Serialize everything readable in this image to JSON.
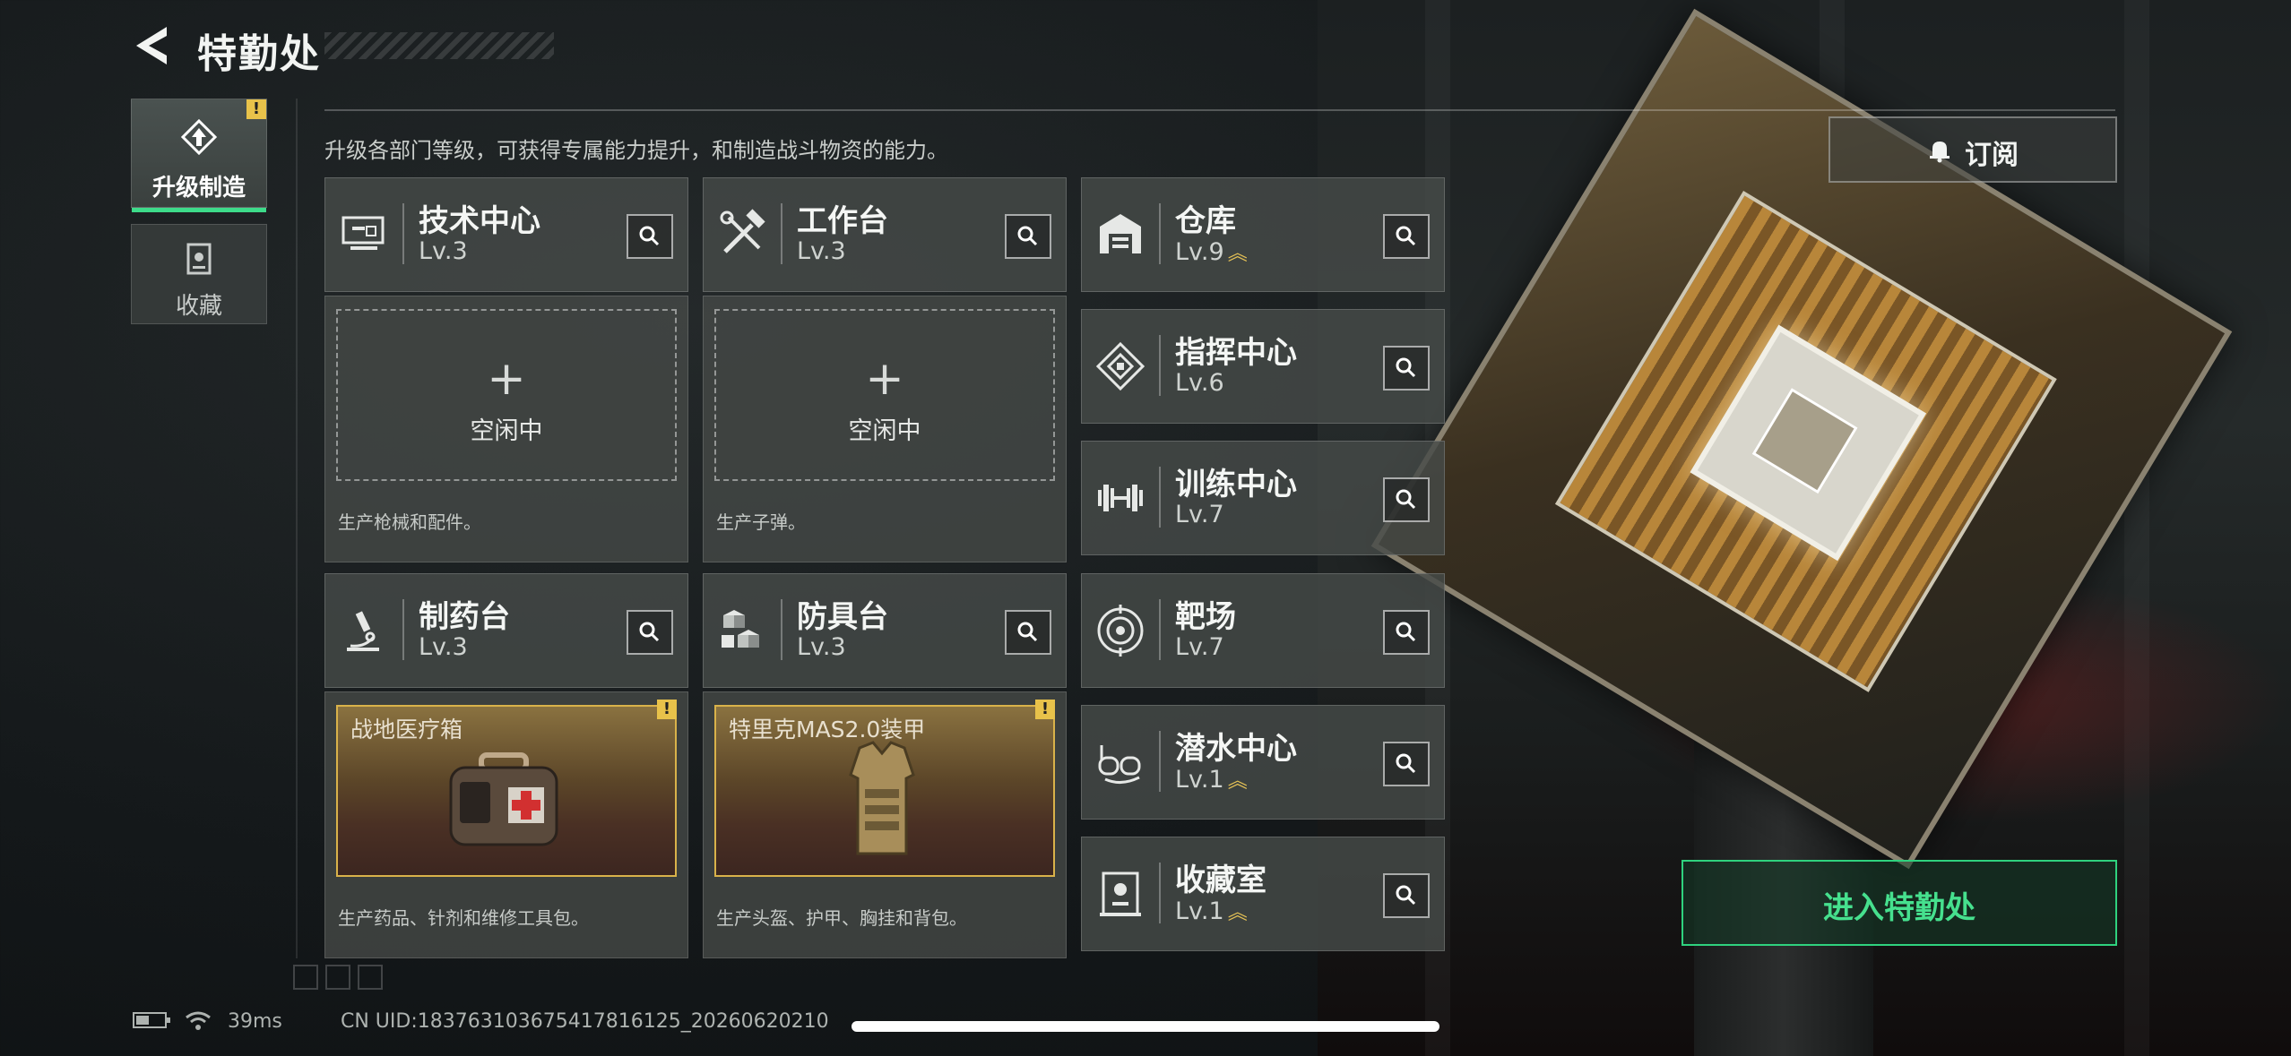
{
  "header": {
    "title": "特勤处",
    "subtitle": "升级各部门等级，可获得专属能力提升，和制造战斗物资的能力。"
  },
  "nav": {
    "tabs": [
      {
        "label": "升级制造",
        "active": true,
        "alert": "!"
      },
      {
        "label": "收藏",
        "active": false
      }
    ]
  },
  "cards": {
    "tech": {
      "name": "技术中心",
      "level": "Lv.3"
    },
    "workbench": {
      "name": "工作台",
      "level": "Lv.3"
    },
    "warehouse": {
      "name": "仓库",
      "level": "Lv.9"
    },
    "command": {
      "name": "指挥中心",
      "level": "Lv.6"
    },
    "training": {
      "name": "训练中心",
      "level": "Lv.7"
    },
    "pharmacy": {
      "name": "制药台",
      "level": "Lv.3"
    },
    "armor": {
      "name": "防具台",
      "level": "Lv.3"
    },
    "range": {
      "name": "靶场",
      "level": "Lv.7"
    },
    "diving": {
      "name": "潜水中心",
      "level": "Lv.1"
    },
    "collection": {
      "name": "收藏室",
      "level": "Lv.1"
    }
  },
  "slots": {
    "tech": {
      "status": "空闲中",
      "desc": "生产枪械和配件。"
    },
    "workbench": {
      "status": "空闲中",
      "desc": "生产子弹。"
    },
    "pharmacy": {
      "product": "战地医疗箱",
      "desc": "生产药品、针剂和维修工具包。"
    },
    "armor": {
      "product": "特里克MAS2.0装甲",
      "desc": "生产头盔、护甲、胸挂和背包。"
    }
  },
  "buttons": {
    "subscribe": "订阅",
    "enter": "进入特勤处"
  },
  "status": {
    "ping": "39ms",
    "uid": "CN UID:183763103675417816125_20260620210"
  },
  "colors": {
    "accent_green": "#2fd27e",
    "alert_yellow": "#e8c24a",
    "upgrade_gold": "#e7c356"
  }
}
